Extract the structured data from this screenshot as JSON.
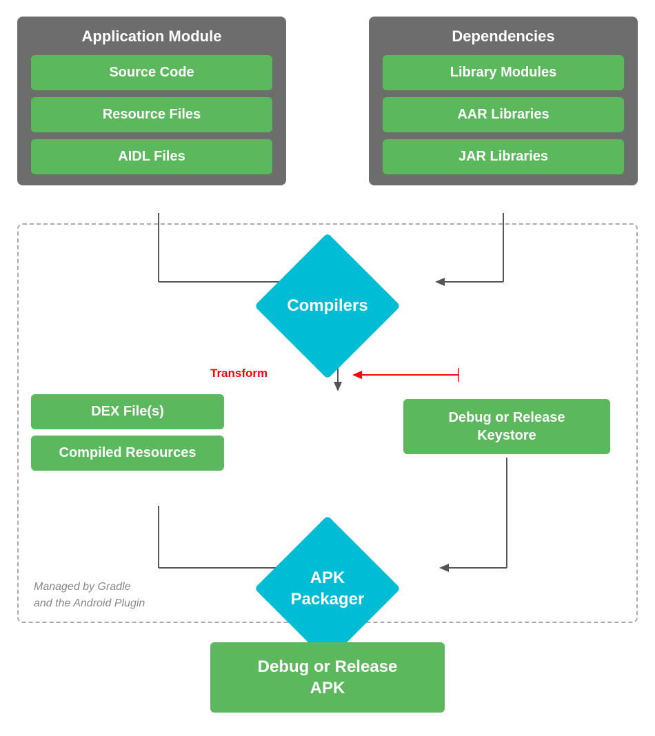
{
  "app_module": {
    "title": "Application Module",
    "items": [
      "Source Code",
      "Resource Files",
      "AIDL Files"
    ]
  },
  "dependencies": {
    "title": "Dependencies",
    "items": [
      "Library Modules",
      "AAR Libraries",
      "JAR Libraries"
    ]
  },
  "compilers": {
    "label": "Compilers"
  },
  "transform": {
    "label": "Transform"
  },
  "dex_files": {
    "label": "DEX File(s)"
  },
  "compiled_resources": {
    "label": "Compiled Resources"
  },
  "keystore": {
    "label": "Debug or Release\nKeystore"
  },
  "apk_packager": {
    "label": "APK\nPackager"
  },
  "output_apk": {
    "label": "Debug or Release\nAPK"
  },
  "gradle_label": {
    "line1": "Managed by Gradle",
    "line2": "and the Android Plugin"
  }
}
